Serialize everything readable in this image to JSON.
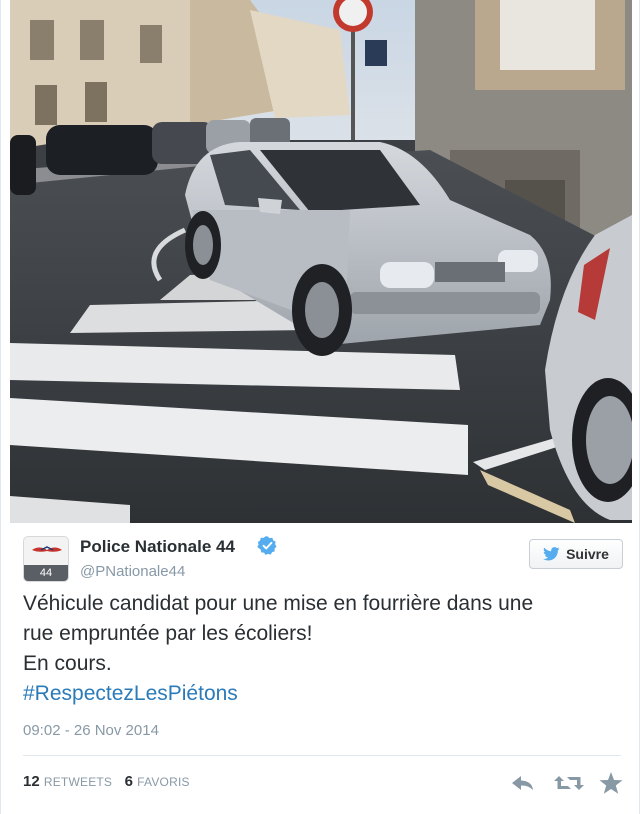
{
  "tweet": {
    "author": {
      "display_name": "Police Nationale 44",
      "handle": "@PNationale44",
      "avatar_label": "44",
      "verified": true
    },
    "follow_button": {
      "label": "Suivre",
      "icon": "twitter-bird-icon"
    },
    "text_lines": [
      "Véhicule candidat pour une mise en fourrière dans une",
      "rue empruntée par les écoliers!",
      "En cours."
    ],
    "hashtag": "#RespectezLesPiétons",
    "timestamp": "09:02 - 26 Nov 2014",
    "stats": {
      "retweets_count": "12",
      "retweets_label": "RETWEETS",
      "favorites_count": "6",
      "favorites_label": "FAVORIS"
    },
    "actions": [
      "reply-icon",
      "retweet-icon",
      "favorite-icon"
    ]
  },
  "colors": {
    "link": "#2b7bb9",
    "verified": "#55acee",
    "muted": "#8899a6",
    "text": "#292f33"
  }
}
